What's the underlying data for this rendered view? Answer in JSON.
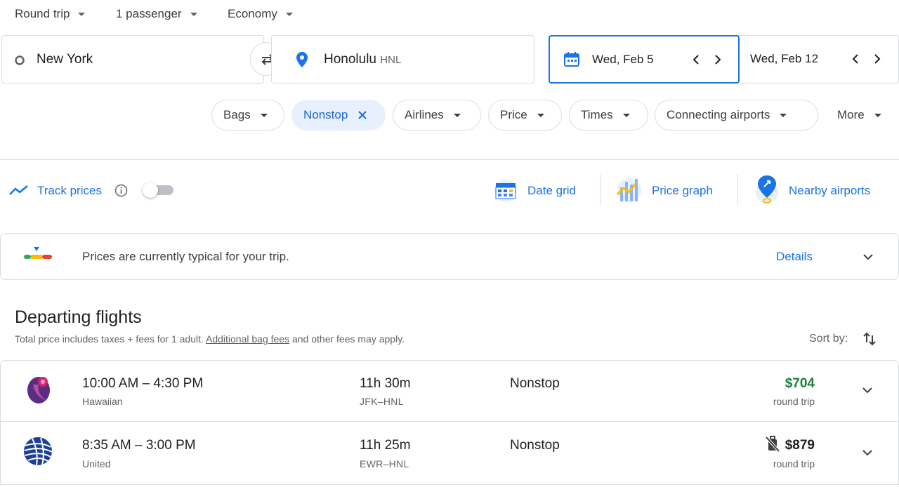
{
  "search_options": {
    "trip_type": "Round trip",
    "passengers": "1 passenger",
    "cabin": "Economy"
  },
  "origin": {
    "value": "New York"
  },
  "destination": {
    "value": "Honolulu",
    "code": "HNL"
  },
  "dates": {
    "depart": "Wed, Feb 5",
    "return": "Wed, Feb 12"
  },
  "filters": [
    {
      "label": "Bags"
    },
    {
      "label": "Nonstop",
      "active": true
    },
    {
      "label": "Airlines"
    },
    {
      "label": "Price"
    },
    {
      "label": "Times"
    },
    {
      "label": "Connecting airports"
    },
    {
      "label": "More"
    }
  ],
  "tools": {
    "track_prices": "Track prices",
    "track_enabled": false,
    "date_grid": "Date grid",
    "price_graph": "Price graph",
    "nearby_airports": "Nearby airports"
  },
  "price_insight": {
    "text": "Prices are currently typical for your trip.",
    "details": "Details"
  },
  "results": {
    "heading": "Departing flights",
    "note_prefix": "Total price includes taxes + fees for 1 adult.",
    "note_link": "Additional bag fees",
    "note_suffix": "and other fees may apply.",
    "sort_label": "Sort by:"
  },
  "flights": [
    {
      "times": "10:00 AM – 4:30 PM",
      "airline": "Hawaiian",
      "duration": "11h 30m",
      "route": "JFK–HNL",
      "stops": "Nonstop",
      "price": "$704",
      "price_type": "round trip",
      "price_color": "#188038",
      "no_carry_on": false
    },
    {
      "times": "8:35 AM – 3:00 PM",
      "airline": "United",
      "duration": "11h 25m",
      "route": "EWR–HNL",
      "stops": "Nonstop",
      "price": "$879",
      "price_type": "round trip",
      "price_color": "#202124",
      "no_carry_on": true
    }
  ],
  "colors": {
    "accent": "#1a73e8",
    "good_price": "#188038",
    "chip_active_bg": "#e8f0fe"
  }
}
